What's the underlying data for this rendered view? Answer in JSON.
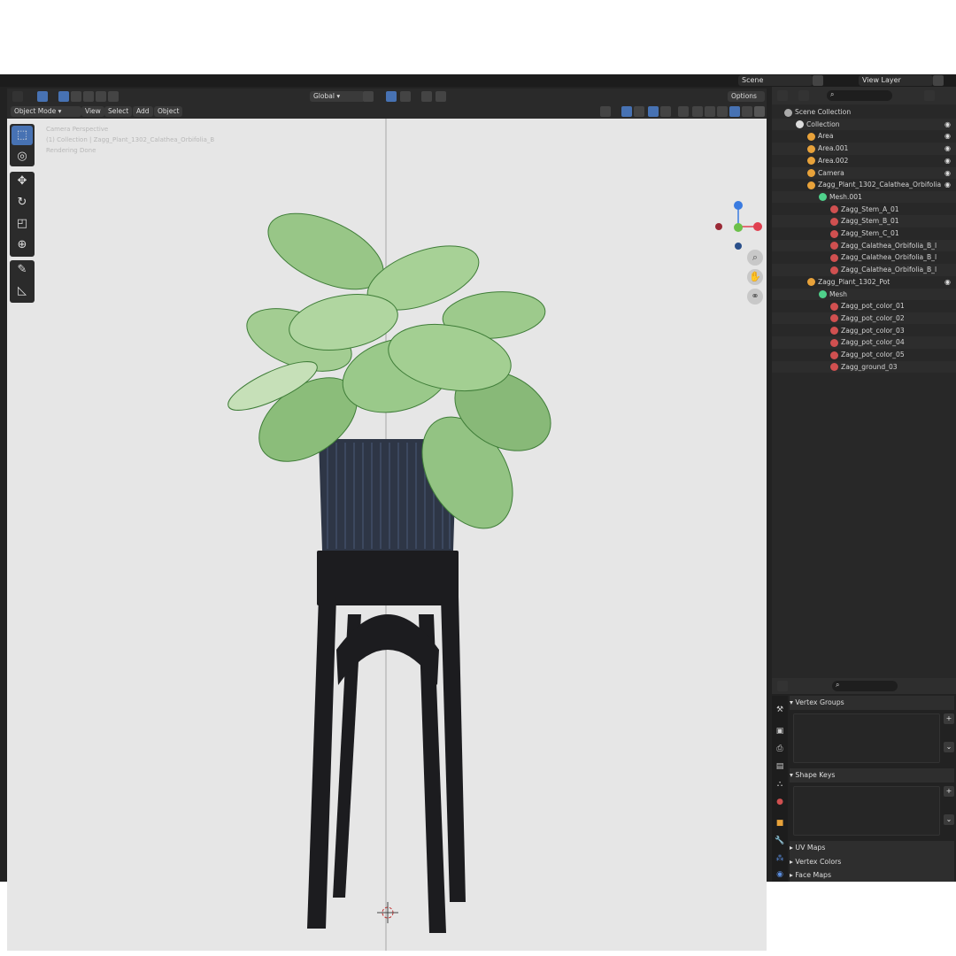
{
  "topbar": {
    "scene_label": "Scene",
    "view_layer_label": "View Layer"
  },
  "viewport_header": {
    "transform_orientation": "Global",
    "options_label": "Options",
    "mode_label": "Object Mode",
    "menus": [
      "View",
      "Select",
      "Add",
      "Object"
    ]
  },
  "viewport_overlay": {
    "line1": "Camera Perspective",
    "line2": "(1) Collection | Zagg_Plant_1302_Calathea_Orbifolia_B",
    "line3": "Rendering Done"
  },
  "outliner": {
    "rows": [
      {
        "label": "Scene Collection",
        "indent": 0,
        "icon": "scene-collection-icon",
        "color": "#aaaaaa",
        "eye": false
      },
      {
        "label": "Collection",
        "indent": 1,
        "icon": "collection-icon",
        "color": "#dddddd",
        "eye": true
      },
      {
        "label": "Area",
        "indent": 2,
        "icon": "light-icon",
        "color": "#e8a23a",
        "eye": true
      },
      {
        "label": "Area.001",
        "indent": 2,
        "icon": "light-icon",
        "color": "#e8a23a",
        "eye": true
      },
      {
        "label": "Area.002",
        "indent": 2,
        "icon": "light-icon",
        "color": "#e8a23a",
        "eye": true
      },
      {
        "label": "Camera",
        "indent": 2,
        "icon": "camera-icon",
        "color": "#e8a23a",
        "eye": true
      },
      {
        "label": "Zagg_Plant_1302_Calathea_Orbifolia",
        "indent": 2,
        "icon": "mesh-object-icon",
        "color": "#e8a23a",
        "eye": true
      },
      {
        "label": "Mesh.001",
        "indent": 3,
        "icon": "mesh-data-icon",
        "color": "#4fd18b",
        "eye": false
      },
      {
        "label": "Zagg_Stem_A_01",
        "indent": 4,
        "icon": "material-icon",
        "color": "#d05050",
        "eye": false
      },
      {
        "label": "Zagg_Stem_B_01",
        "indent": 4,
        "icon": "material-icon",
        "color": "#d05050",
        "eye": false
      },
      {
        "label": "Zagg_Stem_C_01",
        "indent": 4,
        "icon": "material-icon",
        "color": "#d05050",
        "eye": false
      },
      {
        "label": "Zagg_Calathea_Orbifolia_B_l",
        "indent": 4,
        "icon": "material-icon",
        "color": "#d05050",
        "eye": false
      },
      {
        "label": "Zagg_Calathea_Orbifolia_B_l",
        "indent": 4,
        "icon": "material-icon",
        "color": "#d05050",
        "eye": false
      },
      {
        "label": "Zagg_Calathea_Orbifolia_B_l",
        "indent": 4,
        "icon": "material-icon",
        "color": "#d05050",
        "eye": false
      },
      {
        "label": "Zagg_Plant_1302_Pot",
        "indent": 2,
        "icon": "mesh-object-icon",
        "color": "#e8a23a",
        "eye": true
      },
      {
        "label": "Mesh",
        "indent": 3,
        "icon": "mesh-data-icon",
        "color": "#4fd18b",
        "eye": false
      },
      {
        "label": "Zagg_pot_color_01",
        "indent": 4,
        "icon": "material-icon",
        "color": "#d05050",
        "eye": false
      },
      {
        "label": "Zagg_pot_color_02",
        "indent": 4,
        "icon": "material-icon",
        "color": "#d05050",
        "eye": false
      },
      {
        "label": "Zagg_pot_color_03",
        "indent": 4,
        "icon": "material-icon",
        "color": "#d05050",
        "eye": false
      },
      {
        "label": "Zagg_pot_color_04",
        "indent": 4,
        "icon": "material-icon",
        "color": "#d05050",
        "eye": false
      },
      {
        "label": "Zagg_pot_color_05",
        "indent": 4,
        "icon": "material-icon",
        "color": "#d05050",
        "eye": false
      },
      {
        "label": "Zagg_ground_03",
        "indent": 4,
        "icon": "material-icon",
        "color": "#d05050",
        "eye": false
      }
    ]
  },
  "properties": {
    "vertex_groups": "Vertex Groups",
    "shape_keys": "Shape Keys",
    "uv_maps": "UV Maps",
    "vertex_colors": "Vertex Colors",
    "face_maps": "Face Maps"
  },
  "colors": {
    "accent": "#4772b3",
    "viewport_bg": "#e6e6e6",
    "panel_bg": "#282828"
  }
}
